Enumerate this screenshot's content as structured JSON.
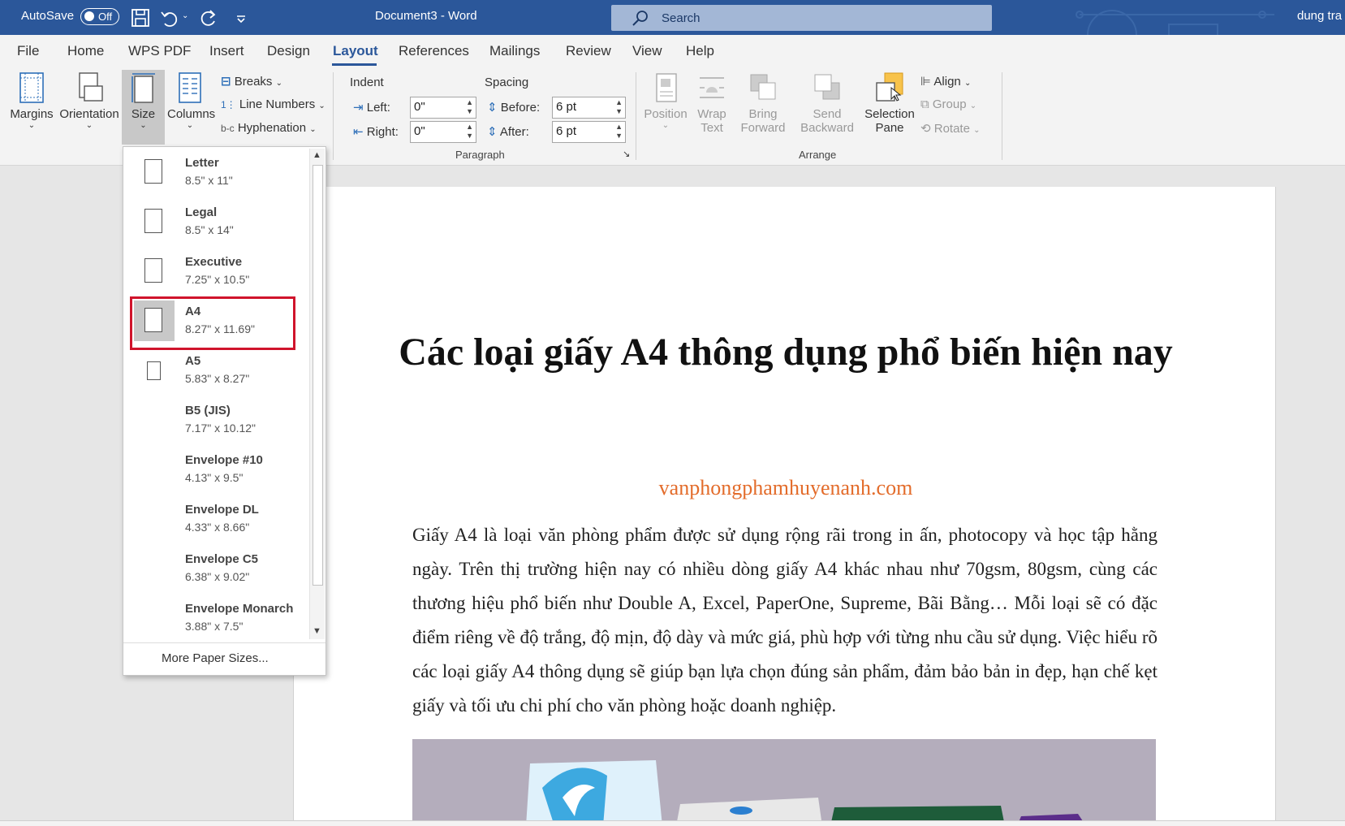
{
  "titlebar": {
    "autosave": "AutoSave",
    "autosave_state": "Off",
    "doc_title": "Document3  -  Word",
    "search_placeholder": "Search",
    "user": "dung tra"
  },
  "tabs": [
    "File",
    "Home",
    "WPS PDF",
    "Insert",
    "Design",
    "Layout",
    "References",
    "Mailings",
    "Review",
    "View",
    "Help"
  ],
  "active_tab": "Layout",
  "ribbon": {
    "page_setup": {
      "margins": "Margins",
      "orientation": "Orientation",
      "size": "Size",
      "columns": "Columns",
      "breaks": "Breaks",
      "line_numbers": "Line Numbers",
      "hyphenation": "Hyphenation"
    },
    "paragraph": {
      "label": "Paragraph",
      "indent": "Indent",
      "spacing": "Spacing",
      "left_label": "Left:",
      "left_value": "0\"",
      "right_label": "Right:",
      "right_value": "0\"",
      "before_label": "Before:",
      "before_value": "6 pt",
      "after_label": "After:",
      "after_value": "6 pt"
    },
    "arrange": {
      "label": "Arrange",
      "position": "Position",
      "wrap_text_1": "Wrap",
      "wrap_text_2": "Text",
      "bring_forward_1": "Bring",
      "bring_forward_2": "Forward",
      "send_backward_1": "Send",
      "send_backward_2": "Backward",
      "selection_pane_1": "Selection",
      "selection_pane_2": "Pane",
      "align": "Align",
      "group": "Group",
      "rotate": "Rotate"
    }
  },
  "size_menu": {
    "items": [
      {
        "name": "Letter",
        "dims": "8.5\" x 11\""
      },
      {
        "name": "Legal",
        "dims": "8.5\" x 14\""
      },
      {
        "name": "Executive",
        "dims": "7.25\" x 10.5\""
      },
      {
        "name": "A4",
        "dims": "8.27\" x 11.69\""
      },
      {
        "name": "A5",
        "dims": "5.83\" x 8.27\""
      },
      {
        "name": "B5 (JIS)",
        "dims": "7.17\" x 10.12\""
      },
      {
        "name": "Envelope #10",
        "dims": "4.13\" x 9.5\""
      },
      {
        "name": "Envelope DL",
        "dims": "4.33\" x 8.66\""
      },
      {
        "name": "Envelope C5",
        "dims": "6.38\" x 9.02\""
      },
      {
        "name": "Envelope Monarch",
        "dims": "3.88\" x 7.5\""
      }
    ],
    "selected": "A4",
    "more": "More Paper Sizes..."
  },
  "document": {
    "title": "Các loại giấy A4 thông dụng phổ biến hiện nay",
    "url": "vanphongphamhuyenanh.com",
    "body": "Giấy A4 là loại văn phòng phẩm được sử dụng rộng rãi trong in ấn, photocopy và học tập hằng ngày. Trên thị trường hiện nay có nhiều dòng giấy A4 khác nhau như 70gsm, 80gsm, cùng các thương hiệu phổ biến như Double A, Excel, PaperOne, Supreme, Bãi Bằng… Mỗi loại sẽ có đặc điểm riêng về độ trắng, độ mịn, độ dày và mức giá, phù hợp với từng nhu cầu sử dụng. Việc hiểu rõ các loại giấy A4 thông dụng sẽ giúp bạn lựa chọn đúng sản phẩm, đảm bảo bản in đẹp, hạn chế kẹt giấy và tối ưu chi phí cho văn phòng hoặc doanh nghiệp."
  },
  "colors": {
    "titlebar": "#2b579a",
    "accent": "#2b579a",
    "url": "#e36c2b",
    "highlight_frame": "#d0142c"
  }
}
